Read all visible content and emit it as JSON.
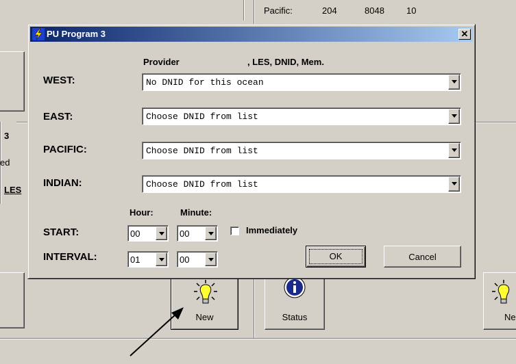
{
  "background": {
    "status_row": {
      "ocean": "Pacific:",
      "les": "204",
      "dnid": "8048",
      "mem": "10"
    },
    "left_fragments": {
      "num": "3",
      "suffix": "ed",
      "les": "LES"
    },
    "new_button_label": "New",
    "status_button_label": "Status",
    "right_new_partial": "Ne"
  },
  "dialog": {
    "title": "PU Program 3",
    "close_glyph": "✕",
    "header_provider": "Provider",
    "header_rest": ", LES,  DNID, Mem.",
    "rows": [
      {
        "label": "WEST:",
        "value": "No DNID for this ocean"
      },
      {
        "label": "EAST:",
        "value": "Choose DNID from list"
      },
      {
        "label": "PACIFIC:",
        "value": "Choose DNID from list"
      },
      {
        "label": "INDIAN:",
        "value": "Choose DNID from list"
      }
    ],
    "hour_label": "Hour:",
    "minute_label": "Minute:",
    "start_label": "START:",
    "interval_label": "INTERVAL:",
    "start_hour": "00",
    "start_minute": "00",
    "interval_hour": "01",
    "interval_minute": "00",
    "immediately_label": "Immediately",
    "ok_label": "OK",
    "cancel_label": "Cancel"
  }
}
